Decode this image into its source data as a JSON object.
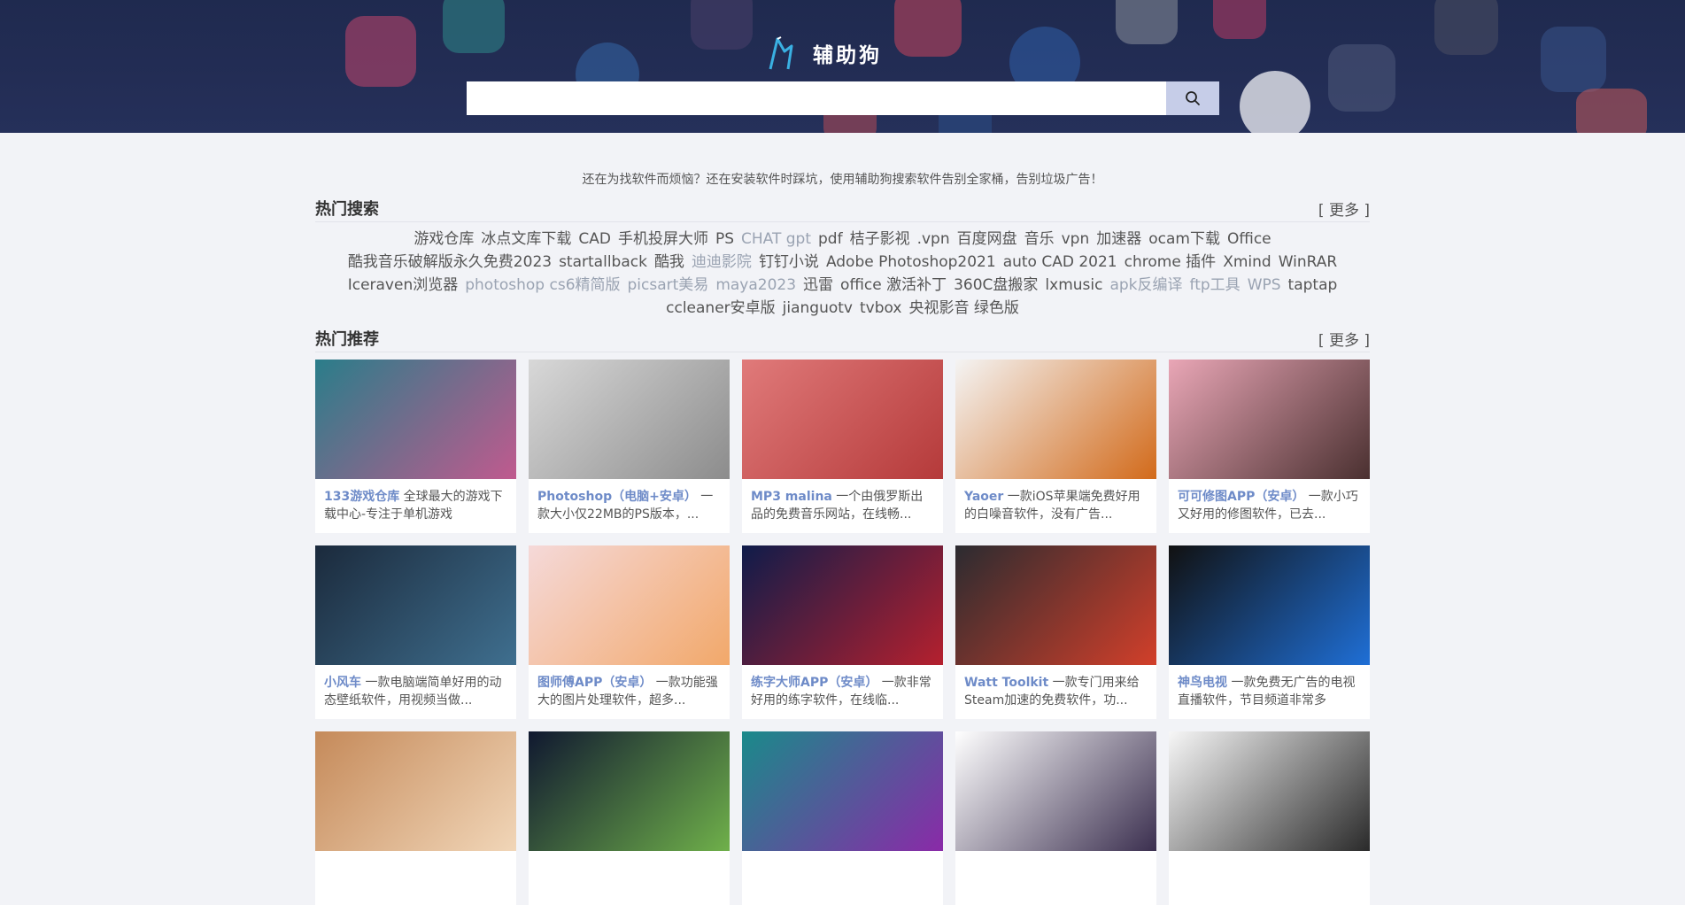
{
  "header": {
    "logo_text": "辅助狗",
    "search_placeholder": "",
    "search_icon": "search-icon"
  },
  "slogan": "还在为找软件而烦恼？还在安装软件时踩坑，使用辅助狗搜索软件告别全家桶，告别垃圾广告！",
  "hot_search": {
    "title": "热门搜索",
    "more": "[ 更多 ]",
    "tags": [
      {
        "text": "游戏仓库"
      },
      {
        "text": "冰点文库下载"
      },
      {
        "text": "CAD"
      },
      {
        "text": "手机投屏大师"
      },
      {
        "text": "PS"
      },
      {
        "text": "CHAT gpt",
        "light": true
      },
      {
        "text": "pdf"
      },
      {
        "text": "桔子影视"
      },
      {
        "text": ".vpn"
      },
      {
        "text": "百度网盘"
      },
      {
        "text": "音乐"
      },
      {
        "text": "vpn"
      },
      {
        "text": "加速器"
      },
      {
        "text": "ocam下载"
      },
      {
        "text": "Office"
      },
      {
        "text": "酷我音乐破解版永久免费2023"
      },
      {
        "text": "startallback"
      },
      {
        "text": "酷我"
      },
      {
        "text": "迪迪影院",
        "light": true
      },
      {
        "text": "钉钉小说"
      },
      {
        "text": "Adobe Photoshop2021"
      },
      {
        "text": "auto CAD 2021"
      },
      {
        "text": "chrome 插件"
      },
      {
        "text": "Xmind"
      },
      {
        "text": "WinRAR"
      },
      {
        "text": "Iceraven浏览器"
      },
      {
        "text": "photoshop cs6精简版",
        "light": true
      },
      {
        "text": "picsart美易",
        "light": true
      },
      {
        "text": "maya2023",
        "light": true
      },
      {
        "text": "迅雷"
      },
      {
        "text": "office 激活补丁"
      },
      {
        "text": "360C盘搬家"
      },
      {
        "text": "lxmusic"
      },
      {
        "text": "apk反编译",
        "light": true
      },
      {
        "text": "ftp工具",
        "light": true
      },
      {
        "text": "WPS",
        "light": true
      },
      {
        "text": "taptap"
      },
      {
        "text": "ccleaner安卓版"
      },
      {
        "text": "jianguotv"
      },
      {
        "text": "tvbox"
      },
      {
        "text": "央视影音 绿色版"
      }
    ]
  },
  "recommend": {
    "title": "热门推荐",
    "more": "[ 更多 ]",
    "cards": [
      {
        "name": "133游戏仓库",
        "desc": " 全球最大的游戏下载中心-专注于单机游戏",
        "colors": [
          "#2a7d8a",
          "#c05a8e"
        ]
      },
      {
        "name": "Photoshop（电脑+安卓）",
        "desc": " 一款大小仅22MB的PS版本，...",
        "colors": [
          "#d8d8d8",
          "#8c8c8c"
        ]
      },
      {
        "name": "MP3 malina",
        "desc": " 一个由俄罗斯出品的免费音乐网站，在线畅...",
        "colors": [
          "#e07a7a",
          "#b53a3a"
        ]
      },
      {
        "name": "Yaoer",
        "desc": " 一款iOS苹果端免费好用的白噪音软件，没有广告...",
        "colors": [
          "#f4f4f4",
          "#d26a1a"
        ]
      },
      {
        "name": "可可修图APP（安卓）",
        "desc": " 一款小巧又好用的修图软件，已去...",
        "colors": [
          "#e9a6b6",
          "#4a3030"
        ]
      },
      {
        "name": "小风车",
        "desc": " 一款电脑端简单好用的动态壁纸软件，用视频当做...",
        "colors": [
          "#1b2a3c",
          "#3f6f8f"
        ]
      },
      {
        "name": "图师傅APP（安卓）",
        "desc": " 一款功能强大的图片处理软件，超多...",
        "colors": [
          "#f5d9d9",
          "#f2a86a"
        ]
      },
      {
        "name": "练字大师APP（安卓）",
        "desc": " 一款非常好用的练字软件，在线临...",
        "colors": [
          "#0f1c4a",
          "#b5202e"
        ]
      },
      {
        "name": "Watt Toolkit",
        "desc": " 一款专门用来给Steam加速的免费软件，功...",
        "colors": [
          "#2b2b30",
          "#d23f2a"
        ]
      },
      {
        "name": "神鸟电视",
        "desc": " 一款免费无广告的电视直播软件，节目频道非常多",
        "colors": [
          "#111111",
          "#1f6fd6"
        ]
      },
      {
        "name": "",
        "desc": "",
        "colors": [
          "#c58a5a",
          "#f1d6b8"
        ]
      },
      {
        "name": "",
        "desc": "",
        "colors": [
          "#101830",
          "#6fb04a"
        ]
      },
      {
        "name": "",
        "desc": "",
        "colors": [
          "#1a8a8a",
          "#8a2aa8"
        ]
      },
      {
        "name": "",
        "desc": "",
        "colors": [
          "#ffffff",
          "#3b2f4f"
        ]
      },
      {
        "name": "",
        "desc": "",
        "colors": [
          "#f7f7f7",
          "#2a2a2a"
        ]
      }
    ]
  },
  "colors": {
    "header_bg": "#1f2a4f",
    "page_bg": "#f2f3f7",
    "accent_link": "#6e8bc8",
    "search_btn": "#c6cde8"
  }
}
